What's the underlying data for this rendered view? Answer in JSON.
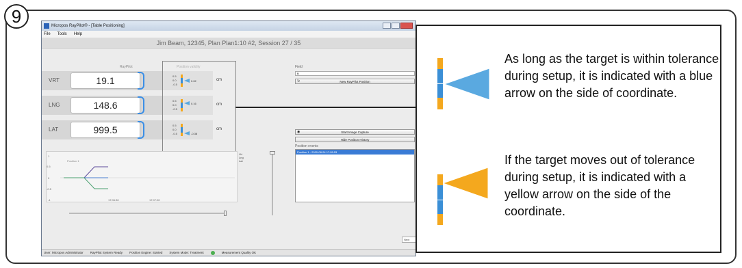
{
  "step_number": "9",
  "window": {
    "title": "Micropos RayPilot® - [Table Positioning]",
    "menu": [
      "File",
      "Tools",
      "Help"
    ]
  },
  "session_text": "Jim Beam, 12345, Plan Plan1:10 #2, Session 27 / 35",
  "section_labels": {
    "raypilot": "RayPilot",
    "position_validity": "Position validity",
    "field": "Field",
    "position_events": "Position events"
  },
  "coordinates": [
    {
      "axis": "VRT",
      "value": "19.1",
      "unit": "cm",
      "offset": "0.02"
    },
    {
      "axis": "LNG",
      "value": "148.6",
      "unit": "cm",
      "offset": "0.16"
    },
    {
      "axis": "LAT",
      "value": "999.5",
      "unit": "cm",
      "offset": "-0.38"
    }
  ],
  "mini_scale": {
    "top": "0.5",
    "mid": "0.0",
    "bottom": "-0.5"
  },
  "field_value": "B",
  "buttons": {
    "new_position": "New RayPilot Position",
    "start_capture": "Start Image Capture",
    "hide_history": "Hide Position History",
    "next": "Next"
  },
  "position_event_item": "Position 1 - 2020-08-24 17:05:53",
  "chart": {
    "series_label": "Position 1",
    "y_ticks": [
      "1",
      "0.5",
      "0",
      "-0.5",
      "-1"
    ],
    "x_ticks": [
      "17:06:30",
      "17:07:00"
    ],
    "legend": [
      "Vrt",
      "Lng",
      "Lat"
    ]
  },
  "status_bar": {
    "user": "User: Micropos Administrator",
    "system": "RayPilot System Ready",
    "engine": "Position Engine: Started",
    "mode": "System Mode: Treatment",
    "quality": "Measurement Quality OK"
  },
  "callout": {
    "blue_text": "As long as the target is within tolerance during setup, it is indicated with a blue arrow on the side of coordinate.",
    "yellow_text": "If the target moves out of tolerance during setup, it is indicated with a yellow arrow on the side of the coordinate.",
    "colors": {
      "blue": "#5aa9e0",
      "yellow": "#f4a81e",
      "bar_blue": "#3b8fd6"
    }
  }
}
